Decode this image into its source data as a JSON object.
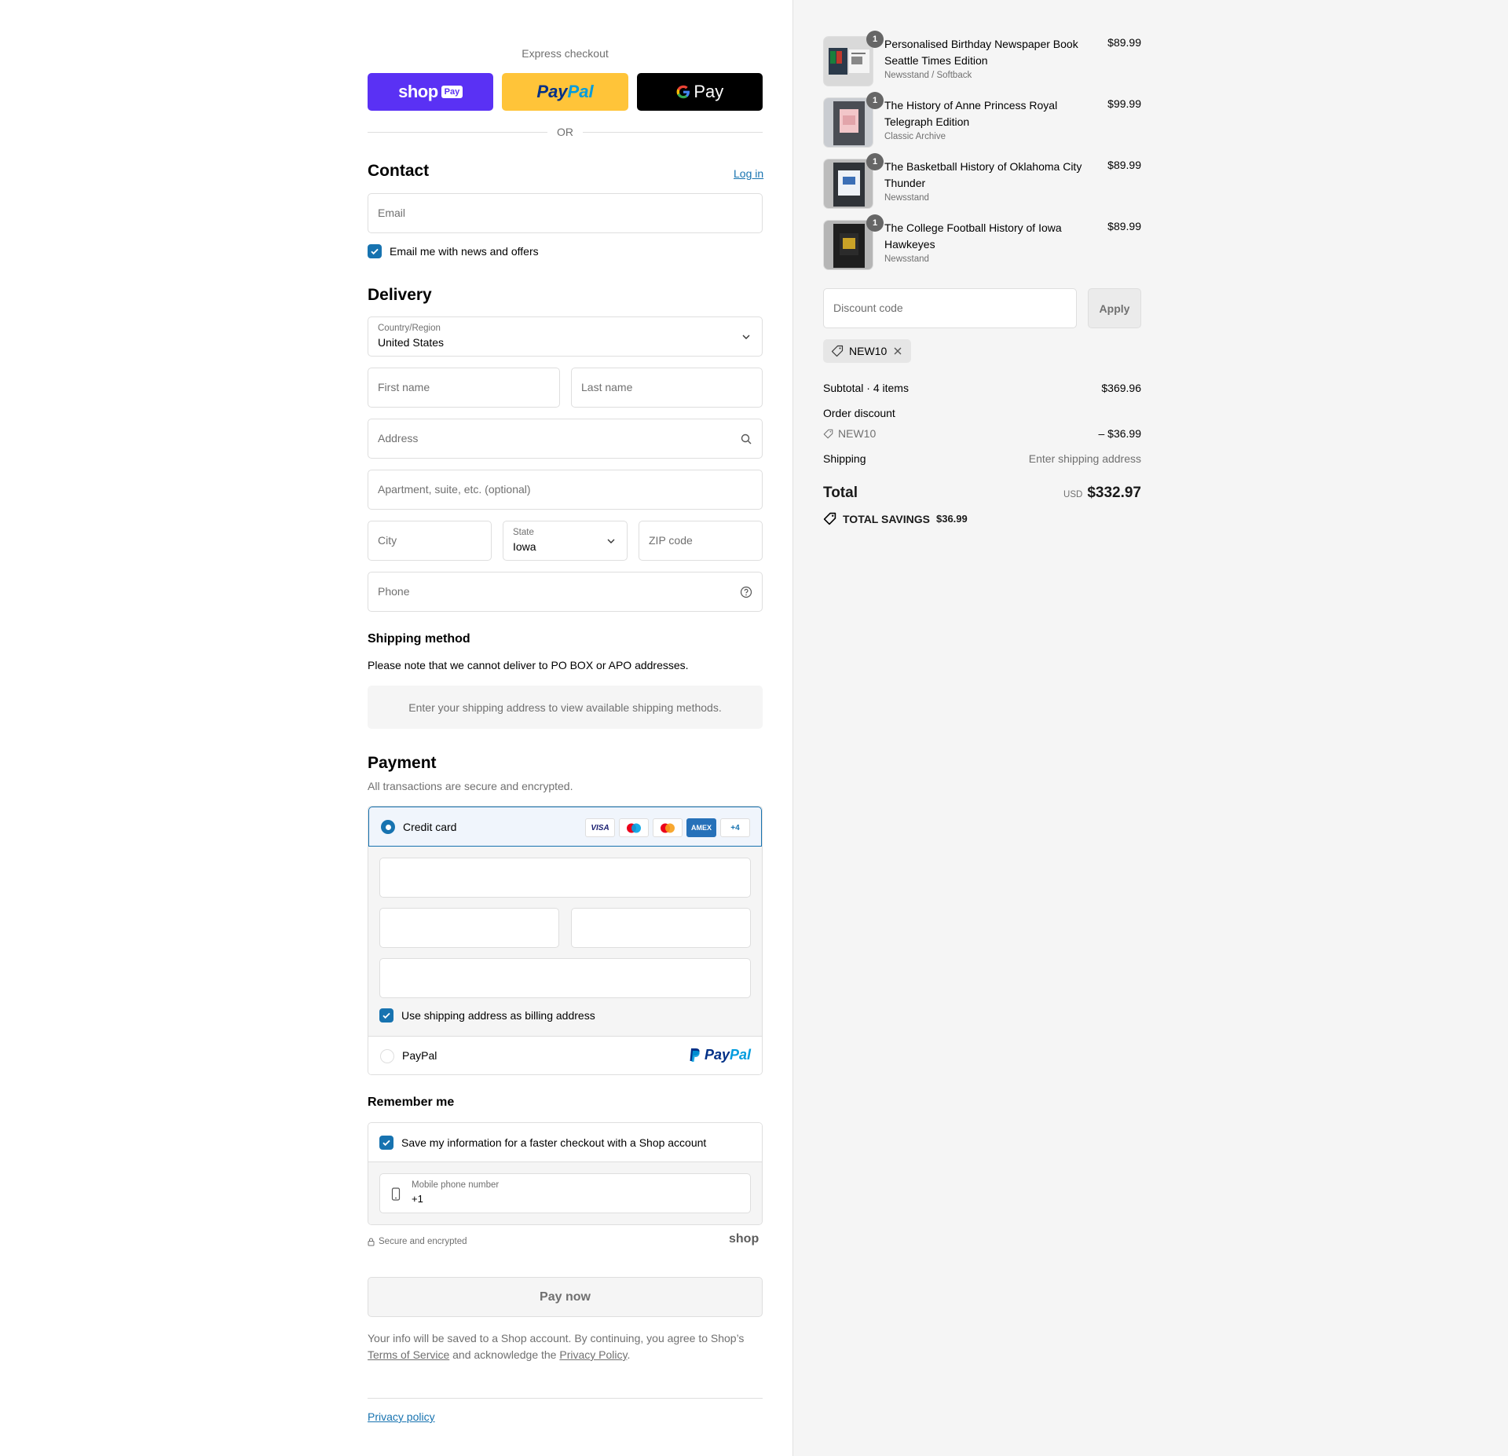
{
  "express": {
    "title": "Express checkout",
    "shop_word": "shop",
    "shop_badge": "Pay",
    "paypal_p1": "Pay",
    "paypal_p2": "Pal",
    "gpay_word": "Pay",
    "or": "OR"
  },
  "contact": {
    "title": "Contact",
    "login": "Log in",
    "email_placeholder": "Email",
    "news_label": "Email me with news and offers",
    "news_checked": true
  },
  "delivery": {
    "title": "Delivery",
    "country_label": "Country/Region",
    "country_value": "United States",
    "first_name": "First name",
    "last_name": "Last name",
    "address": "Address",
    "apartment": "Apartment, suite, etc. (optional)",
    "city": "City",
    "state_label": "State",
    "state_value": "Iowa",
    "zip": "ZIP code",
    "phone": "Phone"
  },
  "shipping_method": {
    "title": "Shipping method",
    "note": "Please note that we cannot deliver to PO BOX or APO addresses.",
    "placeholder": "Enter your shipping address to view available shipping methods."
  },
  "payment": {
    "title": "Payment",
    "subtitle": "All transactions are secure and encrypted.",
    "credit_card_label": "Credit card",
    "cards": [
      "VISA",
      "",
      "",
      "AMEX",
      "+4"
    ],
    "billing_label": "Use shipping address as billing address",
    "paypal_label": "PayPal",
    "paypal_logo_p1": "Pay",
    "paypal_logo_p2": "Pal"
  },
  "remember": {
    "title": "Remember me",
    "save_label": "Save my information for a faster checkout with a Shop account",
    "mobile_label": "Mobile phone number",
    "mobile_value": "+1"
  },
  "secure_text": "Secure and encrypted",
  "shop_logo": "shop",
  "pay_now": "Pay now",
  "legal": {
    "text1": "Your info will be saved to a Shop account. By continuing, you agree to Shop’s",
    "terms": "Terms of Service",
    "text2": "and acknowledge the",
    "privacy": "Privacy Policy",
    "end": "."
  },
  "footer": {
    "privacy_policy": "Privacy policy"
  },
  "cart": {
    "items": [
      {
        "qty": "1",
        "name": "Personalised Birthday Newspaper Book Seattle Times Edition",
        "variant": "Newsstand / Softback",
        "price": "$89.99"
      },
      {
        "qty": "1",
        "name": "The History of Anne Princess Royal Telegraph Edition",
        "variant": "Classic Archive",
        "price": "$99.99"
      },
      {
        "qty": "1",
        "name": "The Basketball History of Oklahoma City Thunder",
        "variant": "Newsstand",
        "price": "$89.99"
      },
      {
        "qty": "1",
        "name": "The College Football History of Iowa Hawkeyes",
        "variant": "Newsstand",
        "price": "$89.99"
      }
    ],
    "discount_placeholder": "Discount code",
    "apply": "Apply",
    "applied_code": "NEW10",
    "subtotal_label": "Subtotal · 4 items",
    "subtotal_value": "$369.96",
    "order_discount_label": "Order discount",
    "discount_code": "NEW10",
    "discount_value": "– $36.99",
    "shipping_label": "Shipping",
    "shipping_value": "Enter shipping address",
    "total_label": "Total",
    "currency": "USD",
    "total_value": "$332.97",
    "savings_label": "TOTAL SAVINGS",
    "savings_value": "$36.99"
  },
  "colors": {
    "accent": "#1773b0",
    "shop_purple": "#5a31f4",
    "paypal_yellow": "#ffc439"
  }
}
